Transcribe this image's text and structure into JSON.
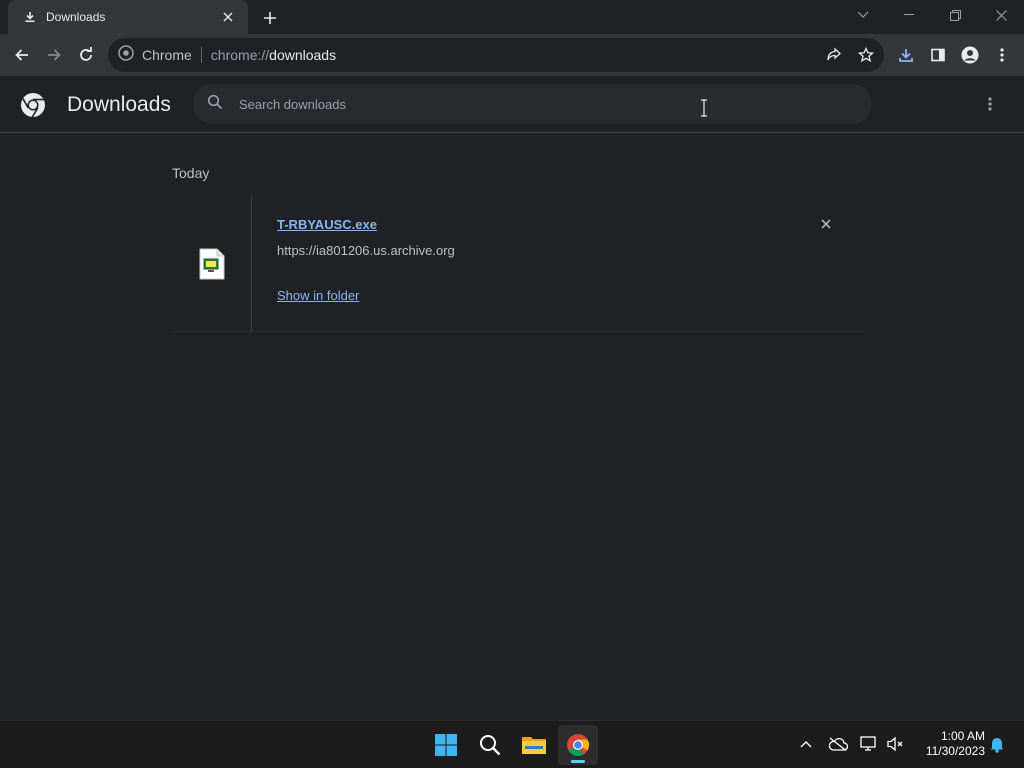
{
  "tab": {
    "title": "Downloads",
    "icon": "download-icon"
  },
  "omnibox": {
    "chip": "Chrome",
    "url_scheme": "chrome://",
    "url_path": "downloads"
  },
  "page": {
    "title": "Downloads",
    "search_placeholder": "Search downloads"
  },
  "downloads": {
    "section": "Today",
    "items": [
      {
        "file_name": "T-RBYAUSC.exe",
        "source_url": "https://ia801206.us.archive.org",
        "action_label": "Show in folder"
      }
    ]
  },
  "taskbar": {
    "time": "1:00 AM",
    "date": "11/30/2023"
  },
  "colors": {
    "accent": "#8ab4f8",
    "bg": "#202124",
    "toolbar": "#35363a"
  }
}
